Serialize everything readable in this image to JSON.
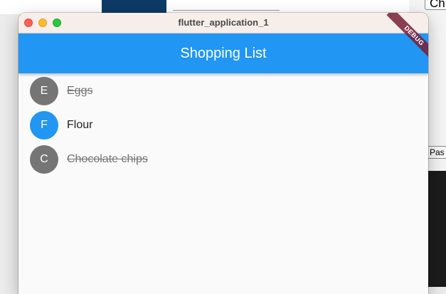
{
  "background": {
    "top_right_button_label": "Ch",
    "mid_right_button_label": "Pas"
  },
  "window": {
    "title": "flutter_application_1"
  },
  "app": {
    "title": "Shopping List",
    "debug_banner": "DEBUG"
  },
  "shopping_list": {
    "items": [
      {
        "initial": "E",
        "name": "Eggs",
        "in_cart": true
      },
      {
        "initial": "F",
        "name": "Flour",
        "in_cart": false
      },
      {
        "initial": "C",
        "name": "Chocolate chips",
        "in_cart": true
      }
    ]
  },
  "colors": {
    "app_bar": "#2196f3",
    "avatar_active": "#2196f3",
    "avatar_in_cart": "#757575",
    "debug_banner": "#7a1e3a"
  }
}
